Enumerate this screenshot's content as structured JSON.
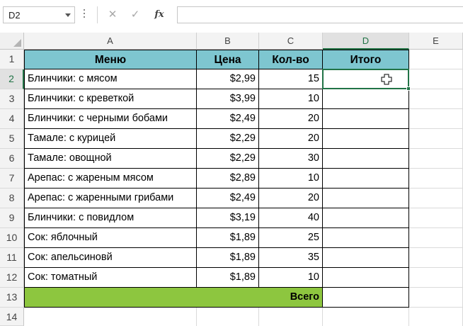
{
  "formula_bar": {
    "name_box": "D2",
    "cancel_icon": "✕",
    "enter_icon": "✓",
    "function_icon": "fx",
    "formula": ""
  },
  "columns": [
    "A",
    "B",
    "C",
    "D",
    "E"
  ],
  "rows": [
    "1",
    "2",
    "3",
    "4",
    "5",
    "6",
    "7",
    "8",
    "9",
    "10",
    "11",
    "12",
    "13",
    "14"
  ],
  "table": {
    "headers": [
      "Меню",
      "Цена",
      "Кол-во",
      "Итого"
    ],
    "items": [
      {
        "menu": "Блинчики: с мясом",
        "price": "$2,99",
        "qty": "15",
        "total": ""
      },
      {
        "menu": "Блинчики: с креветкой",
        "price": "$3,99",
        "qty": "10",
        "total": ""
      },
      {
        "menu": "Блинчики: с черными бобами",
        "price": "$2,49",
        "qty": "20",
        "total": ""
      },
      {
        "menu": "Тамале: с курицей",
        "price": "$2,29",
        "qty": "20",
        "total": ""
      },
      {
        "menu": "Тамале: овощной",
        "price": "$2,29",
        "qty": "30",
        "total": ""
      },
      {
        "menu": "Арепас: с жареным мясом",
        "price": "$2,89",
        "qty": "10",
        "total": ""
      },
      {
        "menu": "Арепас: с жаренными грибами",
        "price": "$2,49",
        "qty": "20",
        "total": ""
      },
      {
        "menu": "Блинчики: с повидлом",
        "price": "$3,19",
        "qty": "40",
        "total": ""
      },
      {
        "menu": "Сок: яблочный",
        "price": "$1,89",
        "qty": "25",
        "total": ""
      },
      {
        "menu": "Сок: апельсиновй",
        "price": "$1,89",
        "qty": "35",
        "total": ""
      },
      {
        "menu": "Сок: томатный",
        "price": "$1,89",
        "qty": "10",
        "total": ""
      }
    ],
    "total_label": "Всего",
    "total_value": ""
  },
  "active_cell": "D2",
  "colors": {
    "header_fill": "#7ec6d0",
    "total_fill": "#8dc63f",
    "selection": "#217346"
  }
}
